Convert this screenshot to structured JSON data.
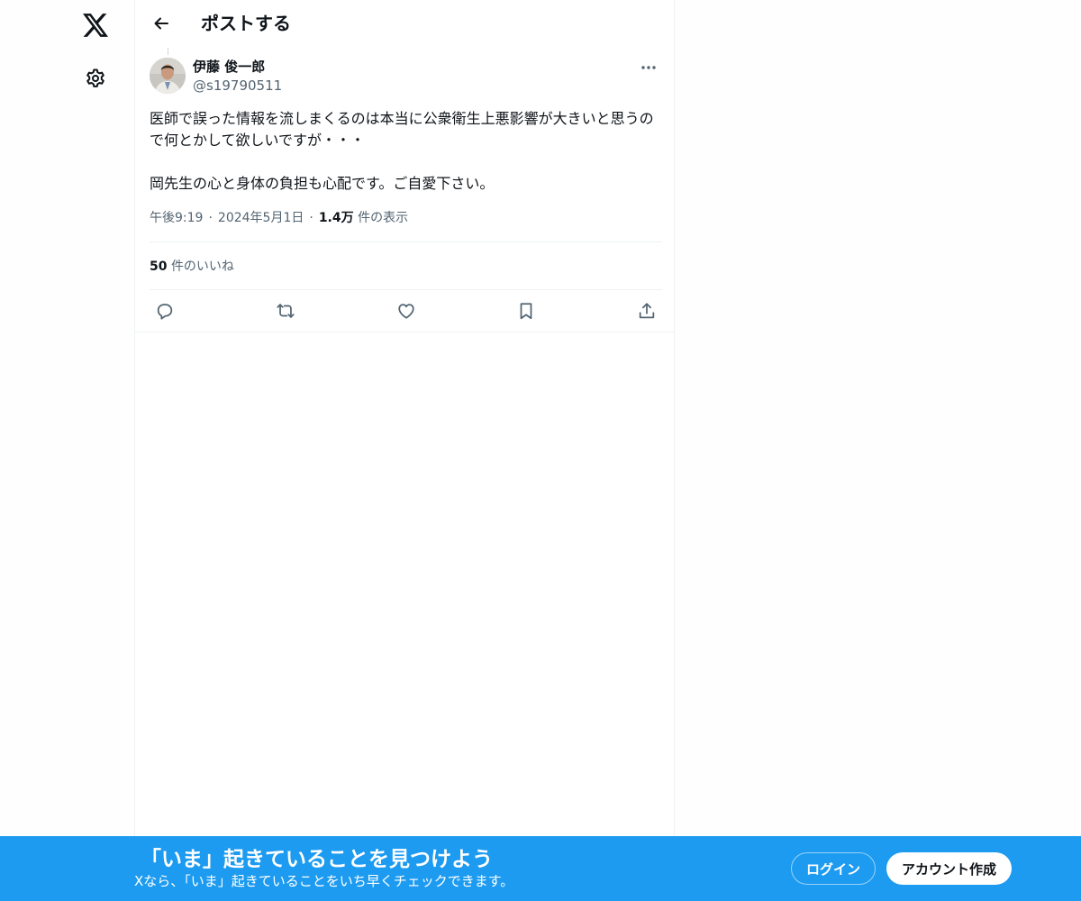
{
  "nav": {
    "logo_icon": "x-logo-icon",
    "settings_icon": "gear-icon"
  },
  "header": {
    "title": "ポストする",
    "back_icon": "arrow-left-icon"
  },
  "post": {
    "author": {
      "display_name": "伊藤 俊一郎",
      "handle": "@s19790511"
    },
    "text": "医師で誤った情報を流しまくるのは本当に公衆衛生上悪影響が大きいと思うので何とかして欲しいですが・・・\n\n岡先生の心と身体の負担も心配です。ご自愛下さい。",
    "time": "午後9:19",
    "date": "2024年5月1日",
    "views_count": "1.4万",
    "views_label": "件の表示",
    "likes_count": "50",
    "likes_label": "件のいいね",
    "actions": [
      "reply-icon",
      "retweet-icon",
      "heart-icon",
      "bookmark-icon",
      "share-icon"
    ]
  },
  "banner": {
    "title": "「いま」起きていることを見つけよう",
    "subtitle": "Xなら、「いま」起きていることをいち早くチェックできます。",
    "login_label": "ログイン",
    "signup_label": "アカウント作成",
    "color": "#1d9bf0"
  }
}
